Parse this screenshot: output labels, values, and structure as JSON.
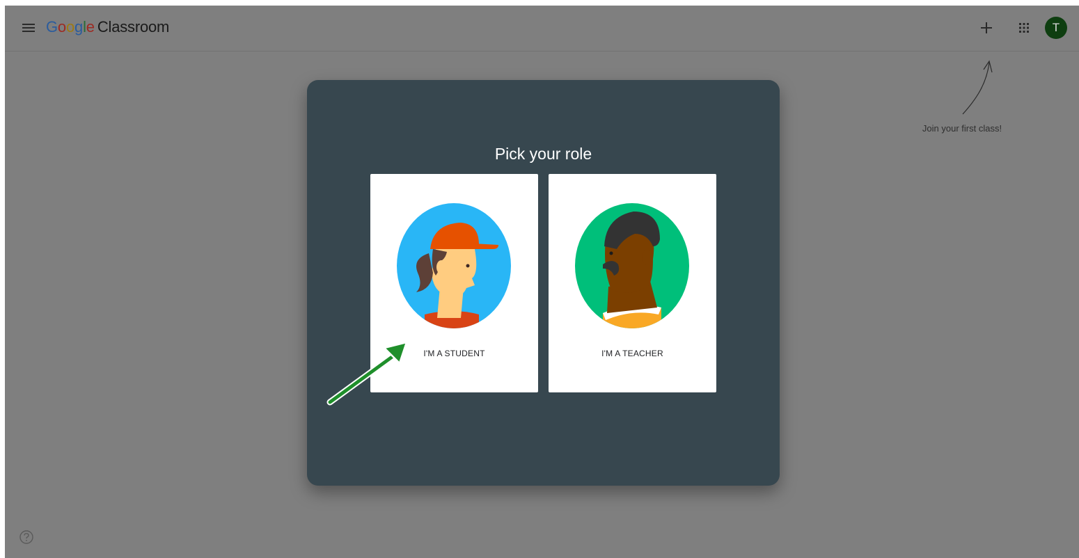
{
  "header": {
    "logo_google_letters": [
      "G",
      "o",
      "o",
      "g",
      "l",
      "e"
    ],
    "logo_product": "Classroom",
    "menu_icon": "hamburger-menu-icon",
    "create_join_icon": "plus-icon",
    "apps_icon": "apps-grid-icon",
    "avatar_initial": "T"
  },
  "hint": {
    "text": "Join your first class!"
  },
  "dialog": {
    "title": "Pick your role",
    "roles": [
      {
        "label": "I'M A STUDENT",
        "illustration": "student-illustration"
      },
      {
        "label": "I'M A TEACHER",
        "illustration": "teacher-illustration"
      }
    ]
  },
  "footer": {
    "help_icon": "help-question-icon"
  },
  "colors": {
    "overlay_background": "#7f7f7f",
    "dialog_background": "#37474f",
    "card_background": "#ffffff",
    "avatar_background": "#0e3e10",
    "student_circle": "#29b6f6",
    "teacher_circle": "#00bf7a",
    "pointer_arrow": "#1f8f2b"
  }
}
